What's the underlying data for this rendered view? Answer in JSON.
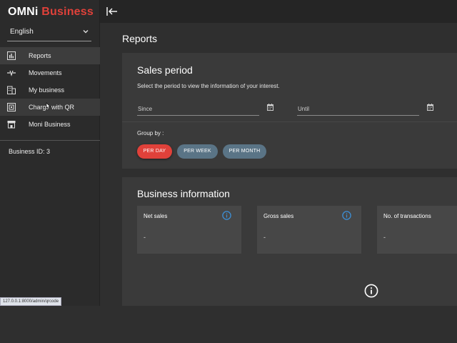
{
  "brand": {
    "part1": "OMNi",
    "part2": "Business",
    "accent": "#e0413a"
  },
  "language": {
    "selected": "English"
  },
  "nav": [
    {
      "label": "Reports",
      "icon": "bar-chart-icon"
    },
    {
      "label": "Movements",
      "icon": "movements-icon"
    },
    {
      "label": "My business",
      "icon": "building-icon"
    },
    {
      "label": "Charge with QR",
      "icon": "qr-code-icon"
    },
    {
      "label": "Moni Business",
      "icon": "store-icon"
    }
  ],
  "business_id": "Business ID: 3",
  "status_url": "127.0.0.1:8000/admin/qrcode",
  "page_title": "Reports",
  "sales_period": {
    "title": "Sales period",
    "subtitle": "Select the period to view the information of your interest.",
    "since_placeholder": "Since",
    "until_placeholder": "Until",
    "group_by_label": "Group by :",
    "chips": [
      "PER DAY",
      "PER WEEK",
      "PER MONTH"
    ]
  },
  "business_info": {
    "title": "Business information",
    "metrics": [
      {
        "label": "Net sales",
        "value": "-"
      },
      {
        "label": "Gross sales",
        "value": "-"
      },
      {
        "label": "No. of transactions",
        "value": "-"
      }
    ]
  }
}
